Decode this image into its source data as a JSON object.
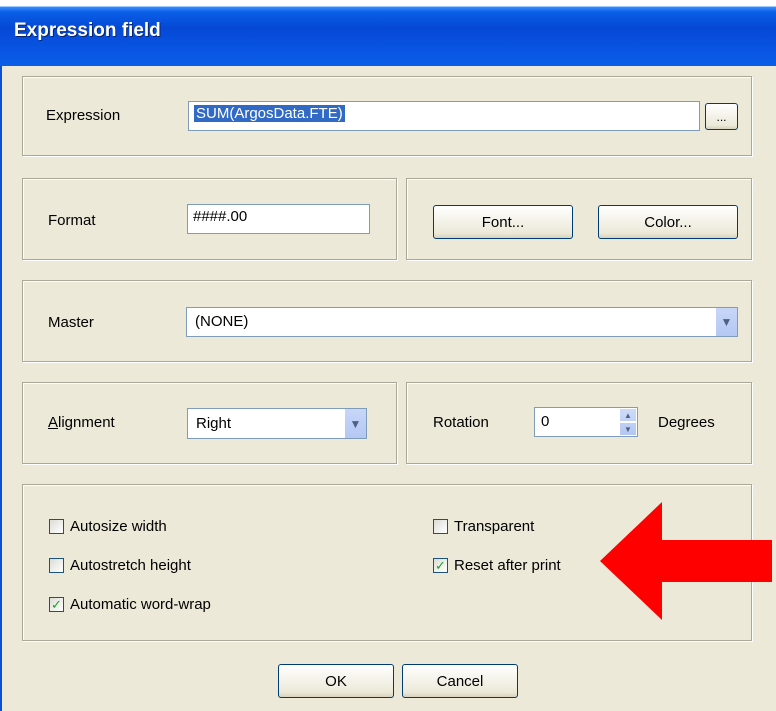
{
  "window": {
    "title": "Expression field"
  },
  "expression": {
    "label": "Expression",
    "value": "SUM(ArgosData.FTE)",
    "browse_label": "..."
  },
  "format": {
    "label": "Format",
    "value": "####.00",
    "font_button": "Font...",
    "color_button": "Color..."
  },
  "master": {
    "label": "Master",
    "selected": "(NONE)"
  },
  "alignment": {
    "label": "Alignment",
    "selected": "Right"
  },
  "rotation": {
    "label": "Rotation",
    "value": "0",
    "unit": "Degrees"
  },
  "options": [
    {
      "label": "Autosize width",
      "checked": false
    },
    {
      "label": "Autostretch height",
      "checked": false
    },
    {
      "label": "Automatic word-wrap",
      "checked": true
    },
    {
      "label": "Transparent",
      "checked": false
    },
    {
      "label": "Reset after print",
      "checked": true
    }
  ],
  "buttons": {
    "ok": "OK",
    "cancel": "Cancel"
  },
  "annotation": {
    "arrow_color": "#ff0000"
  }
}
